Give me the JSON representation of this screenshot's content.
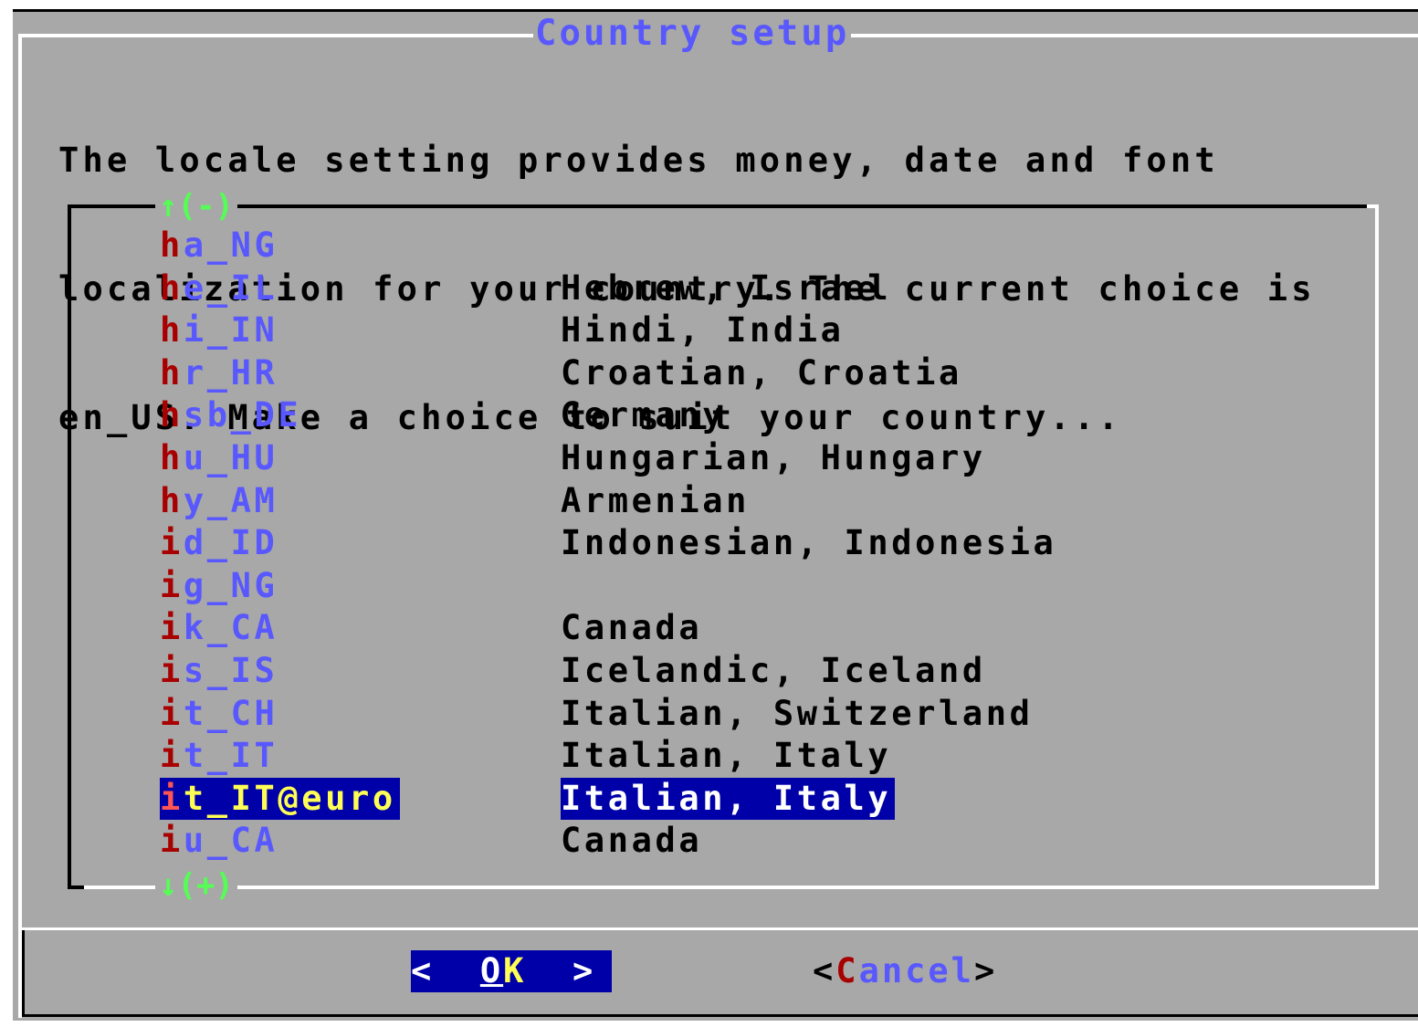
{
  "dialog": {
    "title": "Country setup",
    "description_lines": [
      "The locale setting provides money, date and font",
      "localization for your country. The current choice is",
      "en_US. Make a choice to suit your country..."
    ]
  },
  "list": {
    "scroll_up": "↑(-)",
    "scroll_down": "↓(+)",
    "selected_index": 13,
    "items": [
      {
        "code_hotkey": "h",
        "code_rest": "a_NG",
        "description": ""
      },
      {
        "code_hotkey": "h",
        "code_rest": "e_IL",
        "description": "Hebrew, Israel"
      },
      {
        "code_hotkey": "h",
        "code_rest": "i_IN",
        "description": "Hindi, India"
      },
      {
        "code_hotkey": "h",
        "code_rest": "r_HR",
        "description": "Croatian, Croatia"
      },
      {
        "code_hotkey": "h",
        "code_rest": "sb_DE",
        "description": "Germany"
      },
      {
        "code_hotkey": "h",
        "code_rest": "u_HU",
        "description": "Hungarian, Hungary"
      },
      {
        "code_hotkey": "h",
        "code_rest": "y_AM",
        "description": "Armenian"
      },
      {
        "code_hotkey": "i",
        "code_rest": "d_ID",
        "description": "Indonesian, Indonesia"
      },
      {
        "code_hotkey": "i",
        "code_rest": "g_NG",
        "description": ""
      },
      {
        "code_hotkey": "i",
        "code_rest": "k_CA",
        "description": "Canada"
      },
      {
        "code_hotkey": "i",
        "code_rest": "s_IS",
        "description": "Icelandic, Iceland"
      },
      {
        "code_hotkey": "i",
        "code_rest": "t_CH",
        "description": "Italian, Switzerland"
      },
      {
        "code_hotkey": "i",
        "code_rest": "t_IT",
        "description": "Italian, Italy"
      },
      {
        "code_hotkey": "i",
        "code_rest": "t_IT@euro",
        "description": "Italian, Italy"
      },
      {
        "code_hotkey": "i",
        "code_rest": "u_CA",
        "description": "Canada"
      }
    ]
  },
  "buttons": {
    "ok": {
      "left": "<",
      "hotkey": "O",
      "rest": "K",
      "right": ">"
    },
    "cancel": {
      "left": "<",
      "hotkey": "C",
      "rest": "ancel",
      "right": ">"
    }
  },
  "colors": {
    "dialog_bg": "#a8a8a8",
    "title": "#5858fe",
    "hotkey": "#a80000",
    "selection_bg": "#0000a8",
    "scroll_indicator": "#54fe54"
  }
}
